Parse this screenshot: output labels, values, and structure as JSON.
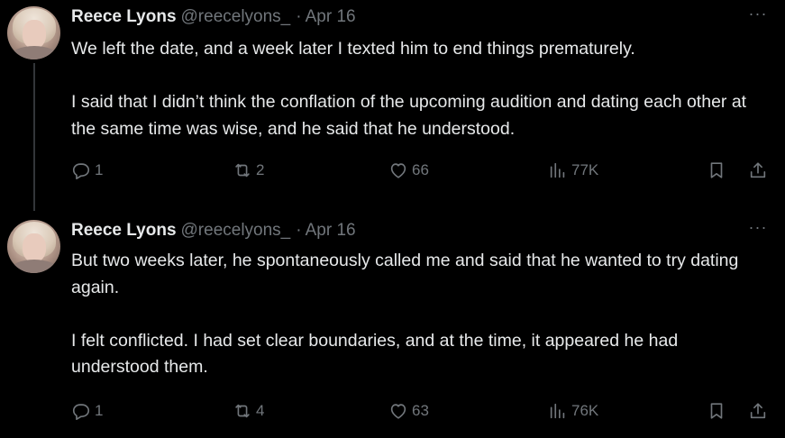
{
  "tweets": [
    {
      "author": {
        "name": "Reece Lyons",
        "handle": "@reecelyons_"
      },
      "separator": "·",
      "date": "Apr 16",
      "text": "We left the date, and a week later I texted him to end things prematurely.\n\nI said that I didn’t think the conflation of the upcoming audition and dating each other at the same time was wise, and he said that he understood.",
      "more_label": "···",
      "stats": {
        "replies": "1",
        "reposts": "2",
        "likes": "66",
        "views": "77K"
      }
    },
    {
      "author": {
        "name": "Reece Lyons",
        "handle": "@reecelyons_"
      },
      "separator": "·",
      "date": "Apr 16",
      "text": "But two weeks later, he spontaneously called me and said that he wanted to try dating again.\n\nI felt conflicted. I had set clear boundaries, and at the time, it appeared he had understood them.",
      "more_label": "···",
      "stats": {
        "replies": "1",
        "reposts": "4",
        "likes": "63",
        "views": "76K"
      }
    }
  ],
  "icons": {
    "reply": "reply-icon",
    "repost": "repost-icon",
    "like": "heart-icon",
    "views": "views-icon",
    "bookmark": "bookmark-icon",
    "share": "share-icon"
  },
  "colors": {
    "background": "#000000",
    "text": "#e7e9ea",
    "muted": "#71767b",
    "thread_line": "#333639"
  }
}
